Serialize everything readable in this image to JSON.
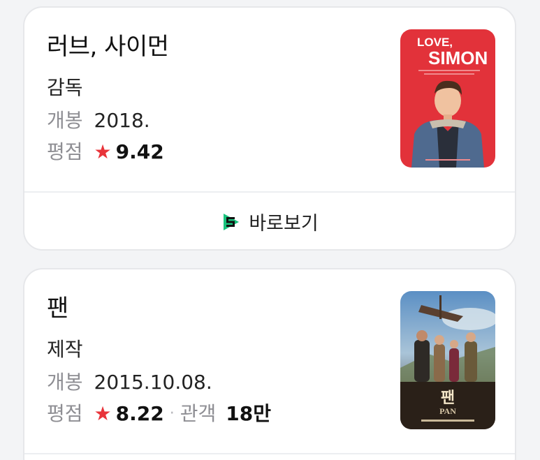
{
  "cards": [
    {
      "title": "러브, 사이먼",
      "role": "감독",
      "release_label": "개봉",
      "release_value": "2018.",
      "rating_label": "평점",
      "star": "★",
      "score": "9.42",
      "poster_title_top": "LOVE,",
      "poster_title_bottom": "SIMON",
      "watch_label": "바로보기",
      "poster_bg": "#e2323a"
    },
    {
      "title": "팬",
      "role": "제작",
      "release_label": "개봉",
      "release_value": "2015.10.08.",
      "rating_label": "평점",
      "star": "★",
      "score": "8.22",
      "separator": "·",
      "audience_label": "관객",
      "audience_value": "18만",
      "poster_title_kr": "팬",
      "poster_title_en": "PAN"
    }
  ],
  "colors": {
    "star": "#e8343a",
    "watch_icon": "#19c37d"
  }
}
